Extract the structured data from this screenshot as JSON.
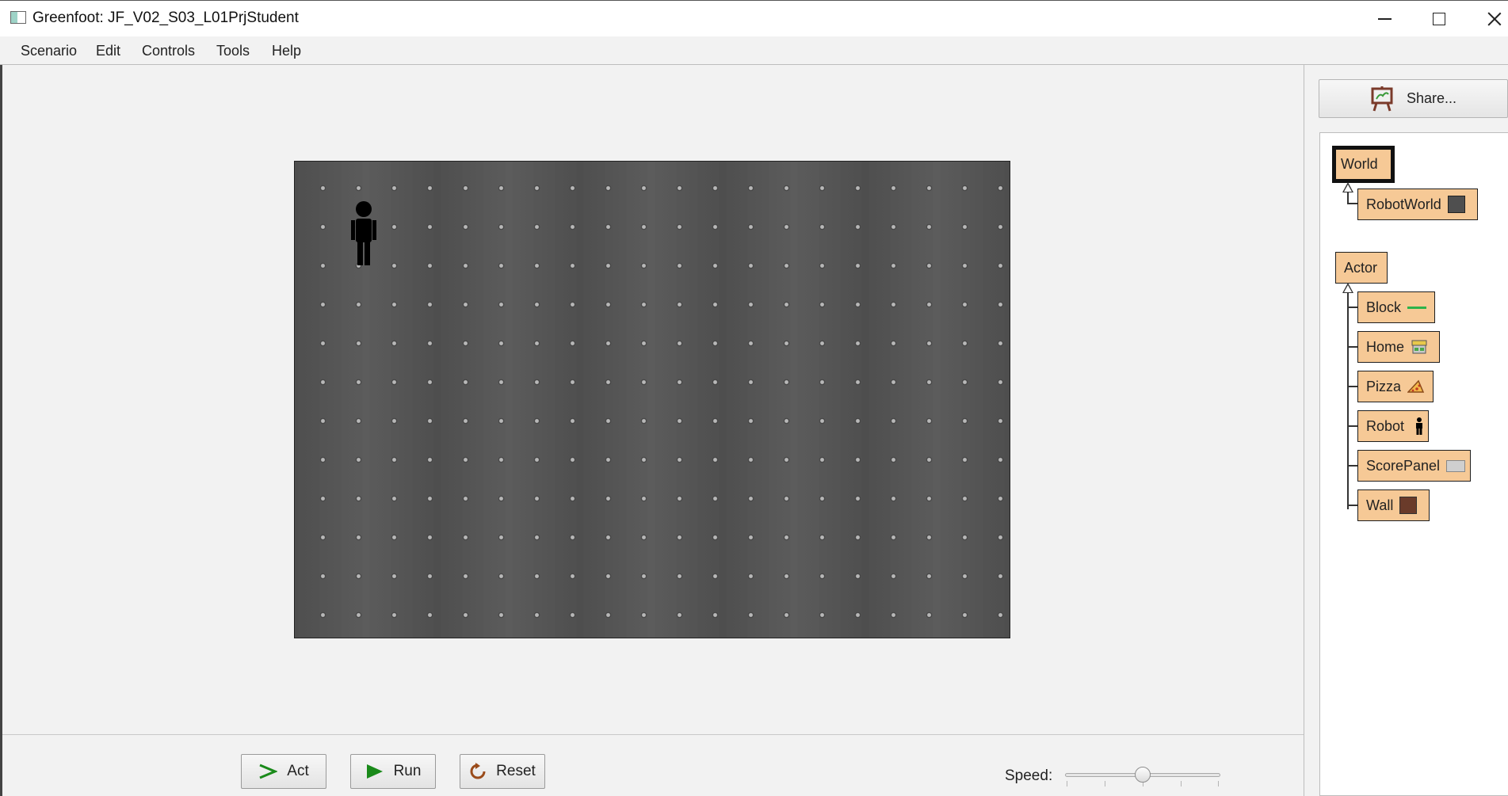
{
  "window": {
    "title": "Greenfoot: JF_V02_S03_L01PrjStudent"
  },
  "menu": {
    "items": [
      "Scenario",
      "Edit",
      "Controls",
      "Tools",
      "Help"
    ]
  },
  "controls": {
    "act_label": "Act",
    "run_label": "Run",
    "reset_label": "Reset",
    "speed_label": "Speed:",
    "speed_value": 0.5
  },
  "share": {
    "label": "Share..."
  },
  "classes": {
    "world_root": "World",
    "world_subclasses": [
      "RobotWorld"
    ],
    "actor_root": "Actor",
    "actor_subclasses": [
      "Block",
      "Home",
      "Pizza",
      "Robot",
      "ScorePanel",
      "Wall"
    ]
  },
  "colors": {
    "class_fill": "#f6c996",
    "world_bg": "#555555",
    "accent_green": "#1a8a1a"
  }
}
